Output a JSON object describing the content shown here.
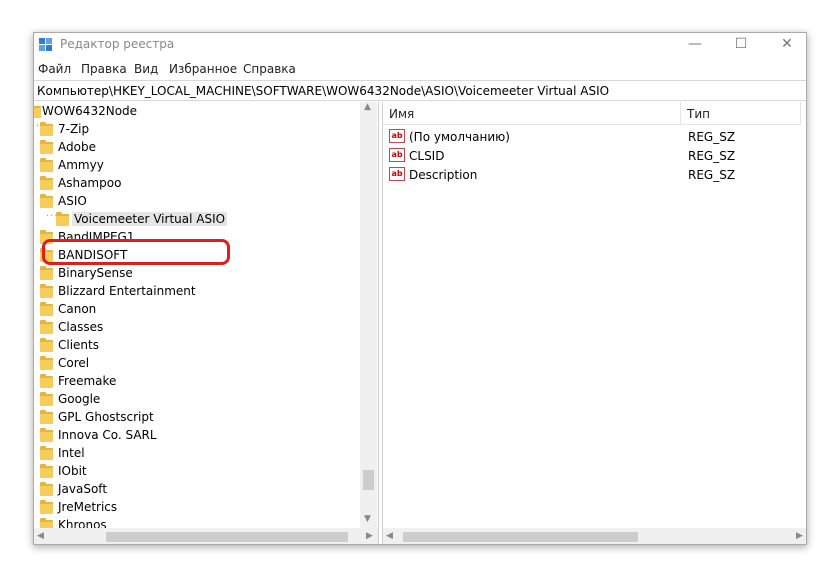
{
  "window": {
    "title": "Редактор реестра",
    "controls": {
      "minimize": "—",
      "maximize": "☐",
      "close": "✕"
    }
  },
  "menu": [
    "Файл",
    "Правка",
    "Вид",
    "Избранное",
    "Справка"
  ],
  "address": "Компьютер\\HKEY_LOCAL_MACHINE\\SOFTWARE\\WOW6432Node\\ASIO\\Voicemeeter Virtual ASIO",
  "tree": {
    "root": "WOW6432Node",
    "items": [
      "7-Zip",
      "Adobe",
      "Ammyy",
      "Ashampoo",
      "ASIO",
      "Voicemeeter Virtual ASIO",
      "BandIMPEG1",
      "BANDISOFT",
      "BinarySense",
      "Blizzard Entertainment",
      "Canon",
      "Classes",
      "Clients",
      "Corel",
      "Freemake",
      "Google",
      "GPL Ghostscript",
      "Innova Co. SARL",
      "Intel",
      "IObit",
      "JavaSoft",
      "JreMetrics",
      "Khronos"
    ],
    "selected": "Voicemeeter Virtual ASIO"
  },
  "values_table": {
    "headers": {
      "name": "Имя",
      "type": "Тип"
    },
    "rows": [
      {
        "name": "(По умолчанию)",
        "type": "REG_SZ"
      },
      {
        "name": "CLSID",
        "type": "REG_SZ"
      },
      {
        "name": "Description",
        "type": "REG_SZ"
      }
    ]
  },
  "colors": {
    "highlight": "#e01e1e",
    "folder": "#f5cd5b"
  }
}
